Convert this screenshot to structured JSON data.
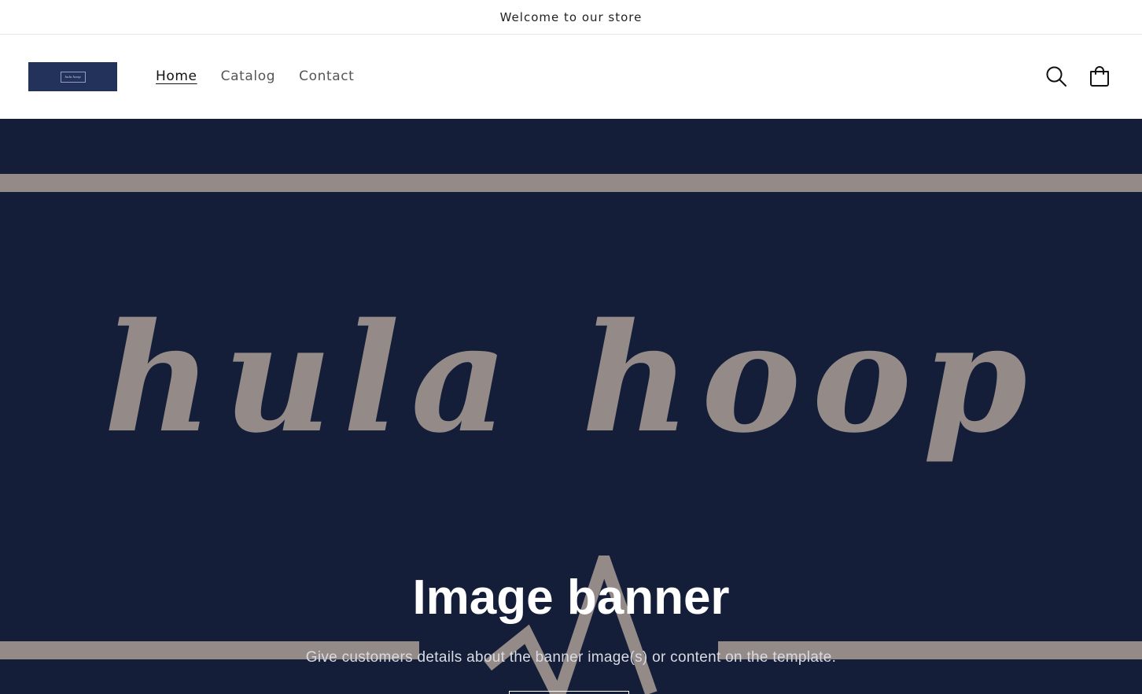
{
  "announcement": {
    "text": "Welcome to our store"
  },
  "header": {
    "logo": {
      "text": "hula hoop"
    },
    "nav": [
      {
        "label": "Home",
        "active": true
      },
      {
        "label": "Catalog",
        "active": false
      },
      {
        "label": "Contact",
        "active": false
      }
    ],
    "icons": {
      "search": "search-icon",
      "cart": "cart-icon"
    }
  },
  "banner": {
    "brand_text": "hula hoop",
    "title": "Image banner",
    "text": "Give customers details about the banner image(s) or content on the template.",
    "colors": {
      "background": "#141e38",
      "accent": "#948b89"
    }
  }
}
